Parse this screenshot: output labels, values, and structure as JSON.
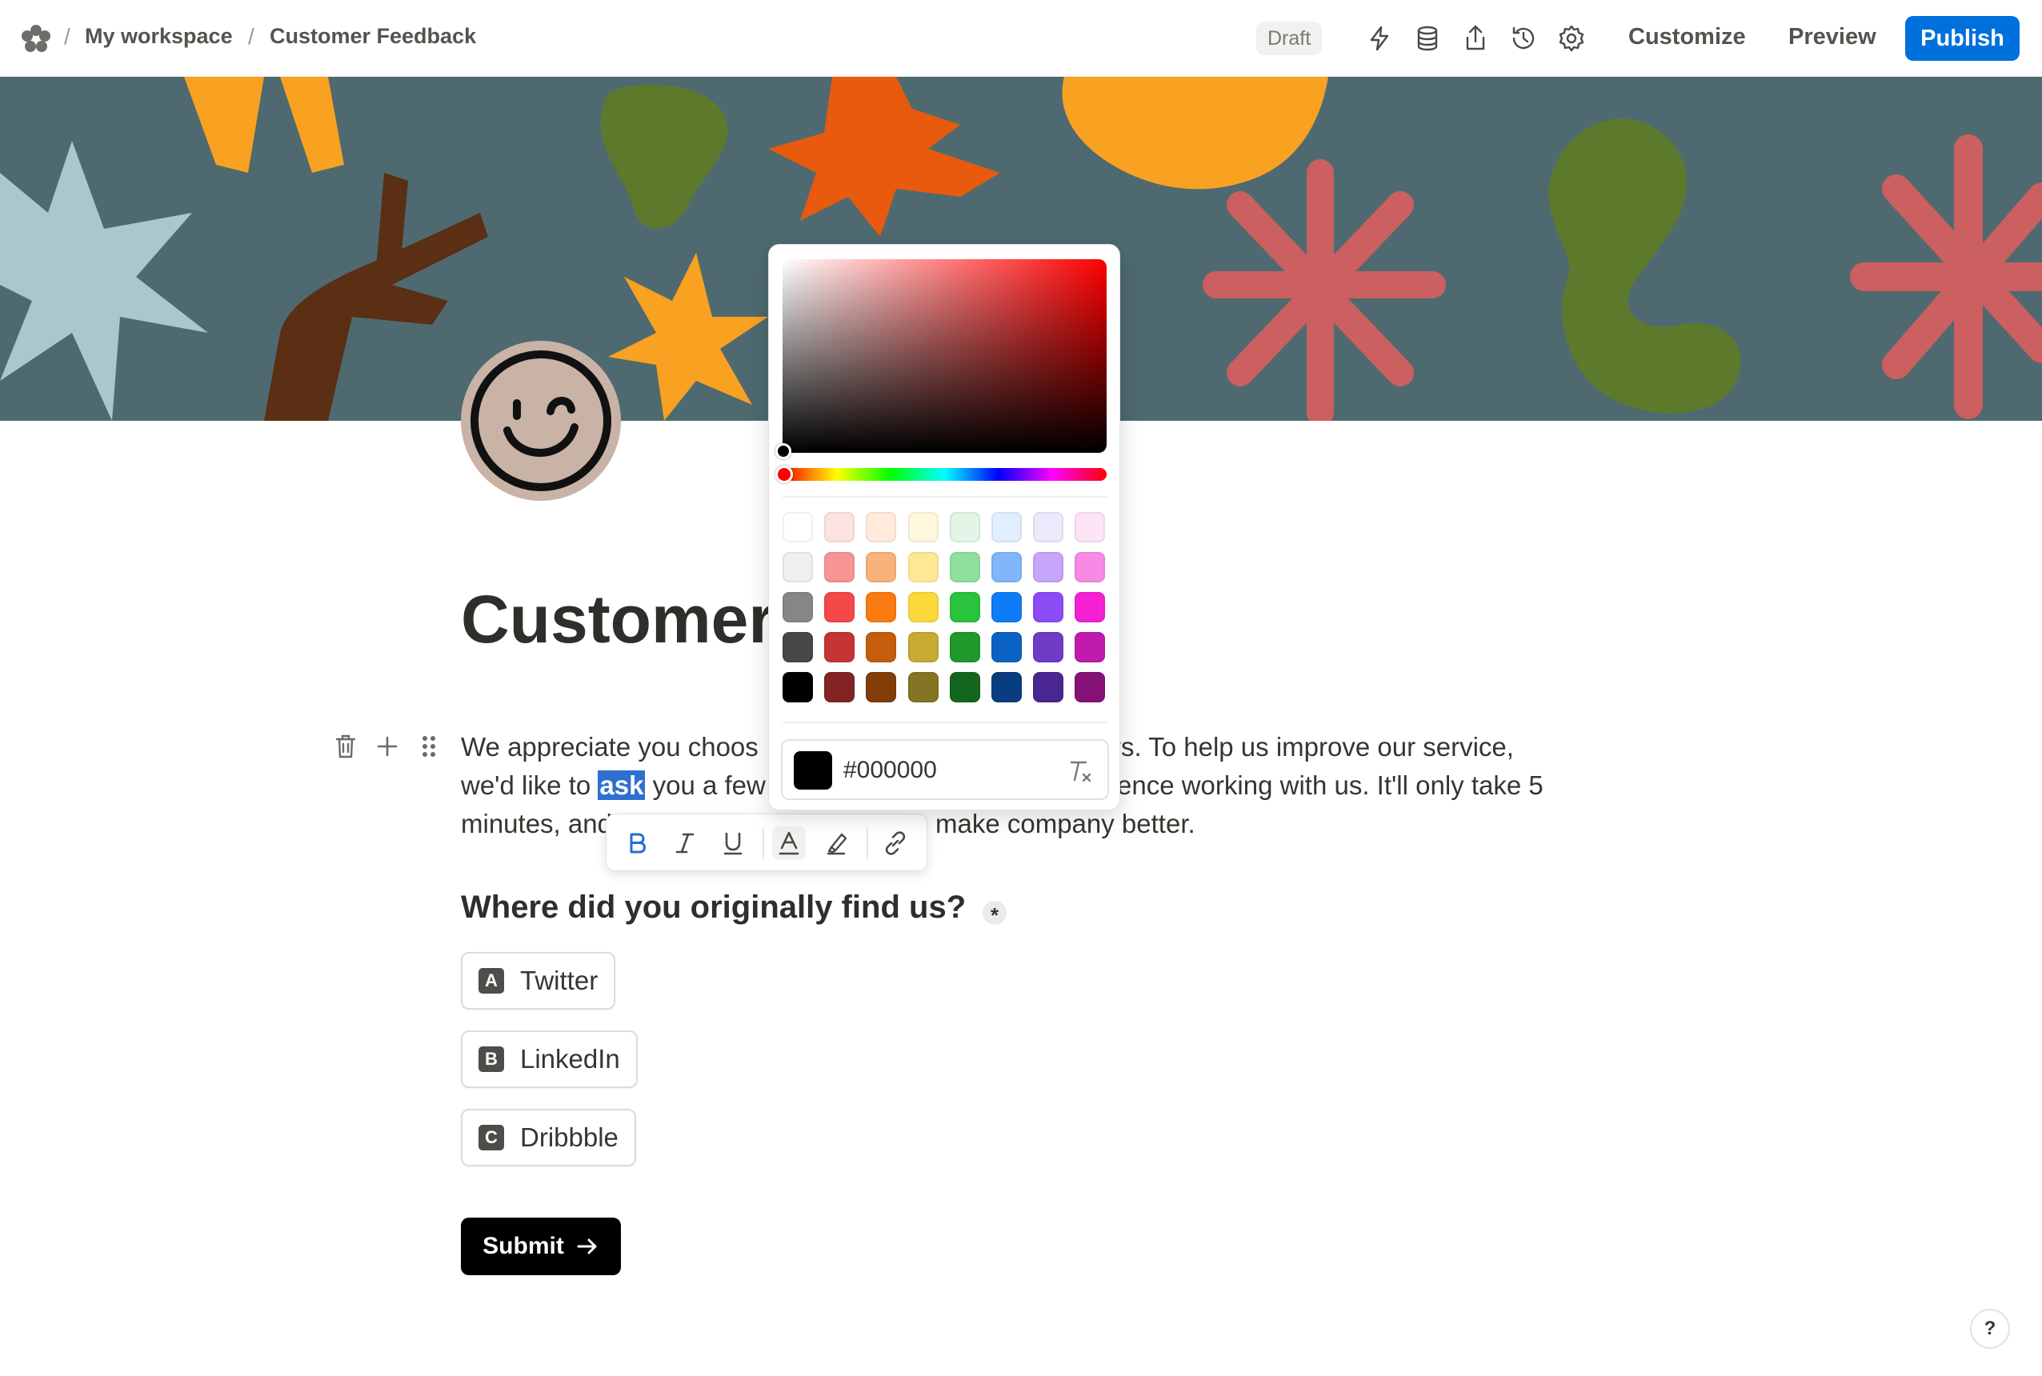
{
  "breadcrumb": {
    "workspace": "My workspace",
    "page": "Customer Feedback",
    "separator": "/"
  },
  "header": {
    "status_badge": "Draft",
    "icons": [
      "lightning-icon",
      "database-icon",
      "share-icon",
      "history-icon",
      "gear-icon"
    ],
    "customize_label": "Customize",
    "preview_label": "Preview",
    "publish_label": "Publish",
    "publish_color": "#0070dc"
  },
  "form": {
    "title": "Customer",
    "intro": {
      "line1_a": "We appreciate you choos",
      "line1_b": "rs. To help us improve our service,",
      "line2_a": "we'd like to ",
      "line2_selected": "ask",
      "line2_b": " you a few",
      "line2_c": "ence working with us. It'll only take 5",
      "line3_a": "minutes, and",
      "line3_b": "make company better."
    },
    "question": "Where did you originally find us?",
    "required_mark": "*",
    "choices": [
      {
        "key": "A",
        "label": "Twitter"
      },
      {
        "key": "B",
        "label": "LinkedIn"
      },
      {
        "key": "C",
        "label": "Dribbble"
      }
    ],
    "submit_label": "Submit"
  },
  "format_toolbar": {
    "tools": [
      "bold-icon",
      "italic-icon",
      "underline-icon",
      "text-color-icon",
      "highlight-icon",
      "link-icon"
    ],
    "active_tool": "text-color-icon"
  },
  "color_picker": {
    "hex_value": "#000000",
    "hue_color": "#ff0000",
    "swatches": [
      [
        "#ffffff",
        "#fde2e2",
        "#ffeadb",
        "#fff7dc",
        "#e3f5e6",
        "#e1eefe",
        "#eee8fd",
        "#fde5f7"
      ],
      [
        "#efefef",
        "#f79494",
        "#f9b27a",
        "#fde894",
        "#8fe09d",
        "#82b6fb",
        "#c5a6fa",
        "#f88ae6"
      ],
      [
        "#868686",
        "#f54848",
        "#f97b12",
        "#fbd93a",
        "#2ac33e",
        "#0f7cf7",
        "#8b4cf6",
        "#f520d4"
      ],
      [
        "#474747",
        "#c53535",
        "#c45e0c",
        "#c7ab33",
        "#1e9a2c",
        "#0b62c2",
        "#6f3bc7",
        "#c01bad"
      ],
      [
        "#000000",
        "#822424",
        "#823d08",
        "#847424",
        "#14661e",
        "#083d80",
        "#4a2790",
        "#861177"
      ]
    ]
  },
  "help_label": "?"
}
